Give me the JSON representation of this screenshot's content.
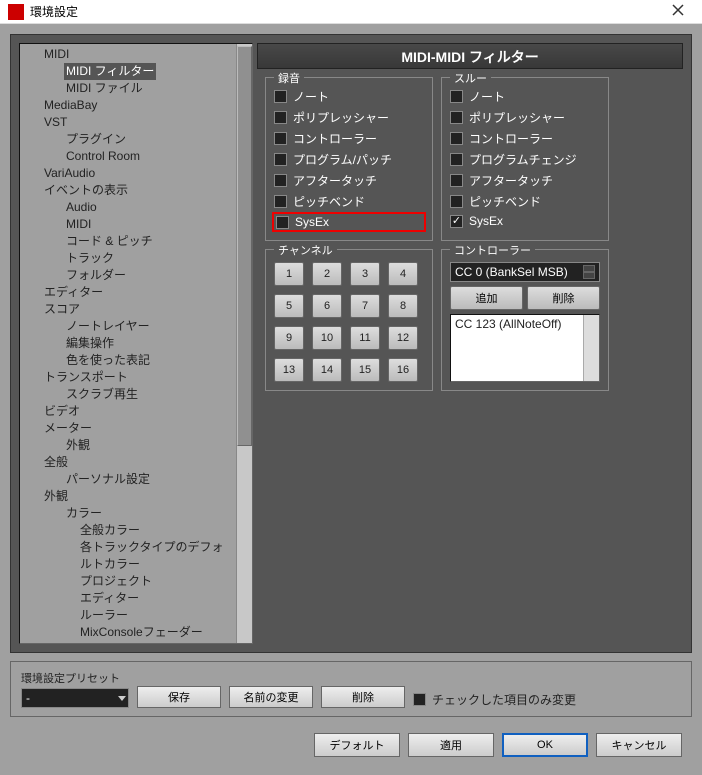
{
  "window": {
    "title": "環境設定"
  },
  "tree": {
    "items": [
      {
        "label": "MIDI",
        "ind": 1
      },
      {
        "label": "MIDI フィルター",
        "ind": 2,
        "selected": true
      },
      {
        "label": "MIDI ファイル",
        "ind": 2
      },
      {
        "label": "MediaBay",
        "ind": 1
      },
      {
        "label": "VST",
        "ind": 1
      },
      {
        "label": "プラグイン",
        "ind": 2
      },
      {
        "label": "Control Room",
        "ind": 2
      },
      {
        "label": "VariAudio",
        "ind": 1
      },
      {
        "label": "イベントの表示",
        "ind": 1
      },
      {
        "label": "Audio",
        "ind": 2
      },
      {
        "label": "MIDI",
        "ind": 2
      },
      {
        "label": "コード & ピッチ",
        "ind": 2
      },
      {
        "label": "トラック",
        "ind": 2
      },
      {
        "label": "フォルダー",
        "ind": 2
      },
      {
        "label": "エディター",
        "ind": 1
      },
      {
        "label": "スコア",
        "ind": 1
      },
      {
        "label": "ノートレイヤー",
        "ind": 2
      },
      {
        "label": "編集操作",
        "ind": 2
      },
      {
        "label": "色を使った表記",
        "ind": 2
      },
      {
        "label": "トランスポート",
        "ind": 1
      },
      {
        "label": "スクラブ再生",
        "ind": 2
      },
      {
        "label": "ビデオ",
        "ind": 1
      },
      {
        "label": "メーター",
        "ind": 1
      },
      {
        "label": "外観",
        "ind": 2
      },
      {
        "label": "全般",
        "ind": 1
      },
      {
        "label": "パーソナル設定",
        "ind": 2
      },
      {
        "label": "外観",
        "ind": 1
      },
      {
        "label": "カラー",
        "ind": 2
      },
      {
        "label": "全般カラー",
        "ind": 3
      },
      {
        "label": "各トラックタイプのデフォルトカラー",
        "ind": 3
      },
      {
        "label": "プロジェクト",
        "ind": 3
      },
      {
        "label": "エディター",
        "ind": 3
      },
      {
        "label": "ルーラー",
        "ind": 3
      },
      {
        "label": "MixConsoleフェーダー",
        "ind": 3
      }
    ]
  },
  "content": {
    "header": "MIDI-MIDI フィルター",
    "record": {
      "title": "録音",
      "items": [
        {
          "label": "ノート",
          "checked": false
        },
        {
          "label": "ポリプレッシャー",
          "checked": false
        },
        {
          "label": "コントローラー",
          "checked": false
        },
        {
          "label": "プログラム/パッチ",
          "checked": false
        },
        {
          "label": "アフタータッチ",
          "checked": false
        },
        {
          "label": "ピッチベンド",
          "checked": false
        },
        {
          "label": "SysEx",
          "checked": false,
          "highlight": true
        }
      ]
    },
    "thru": {
      "title": "スルー",
      "items": [
        {
          "label": "ノート",
          "checked": false
        },
        {
          "label": "ポリプレッシャー",
          "checked": false
        },
        {
          "label": "コントローラー",
          "checked": false
        },
        {
          "label": "プログラムチェンジ",
          "checked": false
        },
        {
          "label": "アフタータッチ",
          "checked": false
        },
        {
          "label": "ピッチベンド",
          "checked": false
        },
        {
          "label": "SysEx",
          "checked": true
        }
      ]
    },
    "channel": {
      "title": "チャンネル",
      "buttons": [
        "1",
        "2",
        "3",
        "4",
        "5",
        "6",
        "7",
        "8",
        "9",
        "10",
        "11",
        "12",
        "13",
        "14",
        "15",
        "16"
      ]
    },
    "controller": {
      "title": "コントローラー",
      "cc_select": "CC 0  (BankSel MSB)",
      "add": "追加",
      "remove": "削除",
      "list": [
        "CC 123  (AllNoteOff)"
      ]
    }
  },
  "preset": {
    "label": "環境設定プリセット",
    "value": "-",
    "save": "保存",
    "rename": "名前の変更",
    "delete": "削除",
    "checkonly": "チェックした項目のみ変更"
  },
  "footer": {
    "default": "デフォルト",
    "apply": "適用",
    "ok": "OK",
    "cancel": "キャンセル"
  }
}
